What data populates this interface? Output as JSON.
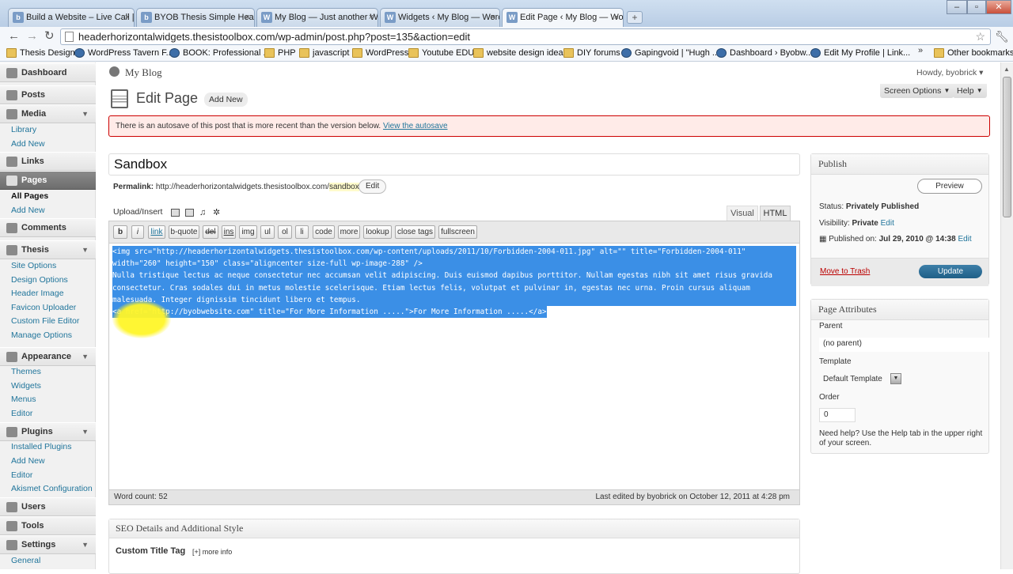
{
  "browser": {
    "tabs": [
      {
        "label": "Build a Website – Live Call |",
        "active": false
      },
      {
        "label": "BYOB Thesis Simple Heade",
        "active": false
      },
      {
        "label": "My Blog — Just another W",
        "active": false
      },
      {
        "label": "Widgets ‹ My Blog — Word",
        "active": false
      },
      {
        "label": "Edit Page ‹ My Blog — Wor",
        "active": true
      }
    ],
    "new_tab": "+",
    "url": "headerhorizontalwidgets.thesistoolbox.com/wp-admin/post.php?post=135&action=edit",
    "bookmarks": [
      "Thesis Design",
      "WordPress Tavern F...",
      "BOOK: Professional ...",
      "PHP",
      "javascript",
      "WordPress",
      "Youtube EDU",
      "website design ideas",
      "DIY forums",
      "Gapingvoid | \"Hugh ...",
      "Dashboard › Byobw...",
      "Edit My Profile | Link..."
    ],
    "more": "»",
    "other_bookmarks": "Other bookmarks"
  },
  "admin_menu": {
    "dashboard": "Dashboard",
    "posts": "Posts",
    "media": "Media",
    "media_items": [
      "Library",
      "Add New"
    ],
    "links": "Links",
    "pages": "Pages",
    "pages_items": [
      "All Pages",
      "Add New"
    ],
    "comments": "Comments",
    "thesis": "Thesis",
    "thesis_items": [
      "Site Options",
      "Design Options",
      "Header Image",
      "Favicon Uploader",
      "Custom File Editor",
      "Manage Options"
    ],
    "appearance": "Appearance",
    "appearance_items": [
      "Themes",
      "Widgets",
      "Menus",
      "Editor"
    ],
    "plugins": "Plugins",
    "plugins_items": [
      "Installed Plugins",
      "Add New",
      "Editor",
      "Akismet Configuration"
    ],
    "users": "Users",
    "tools": "Tools",
    "settings": "Settings",
    "settings_items": [
      "General"
    ]
  },
  "header": {
    "site_name": "My Blog",
    "howdy": "Howdy, byobrick",
    "page_title": "Edit Page",
    "add_new": "Add New",
    "screen_options": "Screen Options",
    "help": "Help"
  },
  "notice": {
    "text": "There is an autosave of this post that is more recent than the version below.",
    "link": "View the autosave"
  },
  "editor": {
    "title": "Sandbox",
    "permalink_label": "Permalink:",
    "permalink_base": "http://headerhorizontalwidgets.thesistoolbox.com/",
    "permalink_slug": "sandbox",
    "permalink_trailing": "/",
    "permalink_edit": "Edit",
    "upload_insert": "Upload/Insert",
    "tab_visual": "Visual",
    "tab_html": "HTML",
    "quicktags": [
      "b",
      "i",
      "link",
      "b-quote",
      "del",
      "ins",
      "img",
      "ul",
      "ol",
      "li",
      "code",
      "more",
      "lookup",
      "close tags",
      "fullscreen"
    ],
    "content_lines": [
      "<img src=\"http://headerhorizontalwidgets.thesistoolbox.com/wp-content/uploads/2011/10/Forbidden-2004-011.jpg\" alt=\"\" title=\"Forbidden-2004-011\"",
      "width=\"260\" height=\"150\" class=\"aligncenter size-full wp-image-288\" />",
      "Nulla tristique lectus ac neque consectetur nec accumsan velit adipiscing. Duis euismod dapibus porttitor. Nullam egestas nibh sit amet risus gravida",
      "consectetur. Cras sodales dui in metus molestie scelerisque. Etiam lectus felis, volutpat et pulvinar in, egestas nec urna. Proin cursus aliquam",
      "malesuada. Integer dignissim tincidunt libero et tempus.",
      "<a href=\"http://byobwebsite.com\" title=\"For More Information .....\">For More Information .....</a>"
    ],
    "word_count": "Word count: 52",
    "last_edited": "Last edited by byobrick on October 12, 2011 at 4:28 pm"
  },
  "seo": {
    "title": "SEO Details and Additional Style",
    "custom_title_tag": "Custom Title Tag",
    "more_info": "[+] more info"
  },
  "publish": {
    "title": "Publish",
    "preview": "Preview",
    "status_label": "Status:",
    "status_value": "Privately Published",
    "visibility_label": "Visibility:",
    "visibility_value": "Private",
    "visibility_edit": "Edit",
    "published_label": "Published on:",
    "published_value": "Jul 29, 2010 @ 14:38",
    "published_edit": "Edit",
    "trash": "Move to Trash",
    "update": "Update"
  },
  "page_attributes": {
    "title": "Page Attributes",
    "parent_label": "Parent",
    "parent_value": "(no parent)",
    "template_label": "Template",
    "template_value": "Default Template",
    "order_label": "Order",
    "order_value": "0",
    "help": "Need help? Use the Help tab in the upper right of your screen."
  },
  "colors": {
    "selection": "#3b8fe6",
    "link": "#21759b",
    "notice_border": "#cc0000",
    "update_button": "#1f5f87"
  }
}
